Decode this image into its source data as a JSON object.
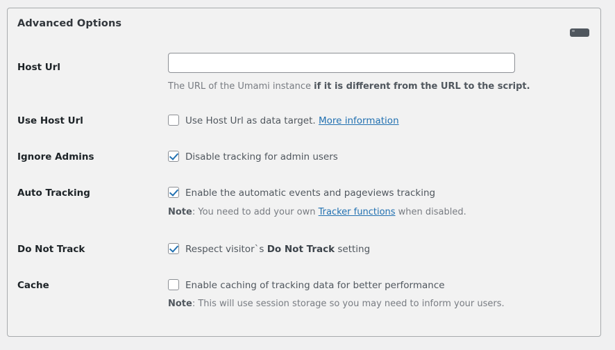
{
  "panel": {
    "title": "Advanced Options",
    "collapse_toggle_name": "minimize-icon"
  },
  "fields": {
    "host_url": {
      "label": "Host Url",
      "value": "",
      "placeholder": "",
      "description_normal": "The URL of the Umami instance ",
      "description_bold": "if it is different from the URL to the script."
    },
    "use_host_url": {
      "label": "Use Host Url",
      "checked": false,
      "checkbox_text": "Use Host Url as data target.",
      "link_text": "More information"
    },
    "ignore_admins": {
      "label": "Ignore Admins",
      "checked": true,
      "checkbox_text": "Disable tracking for admin users"
    },
    "auto_tracking": {
      "label": "Auto Tracking",
      "checked": true,
      "checkbox_text": "Enable the automatic events and pageviews tracking",
      "note_prefix": "Note",
      "note_mid": ": You need to add your own ",
      "note_link": "Tracker functions",
      "note_suffix": " when disabled."
    },
    "do_not_track": {
      "label": "Do Not Track",
      "checked": true,
      "text_before": "Respect visitor`s ",
      "text_bold": "Do Not Track",
      "text_after": " setting"
    },
    "cache": {
      "label": "Cache",
      "checked": false,
      "checkbox_text": "Enable caching of tracking data for better performance",
      "note_prefix": "Note",
      "note_rest": ": This will use session storage so you may need to inform your users."
    }
  },
  "colors": {
    "accent_link": "#2271b1",
    "panel_bg": "#f2f2f2",
    "page_bg": "#f0f0f1",
    "border": "#a7aaad",
    "label_text": "#1d2327",
    "muted_text": "#787c82"
  }
}
